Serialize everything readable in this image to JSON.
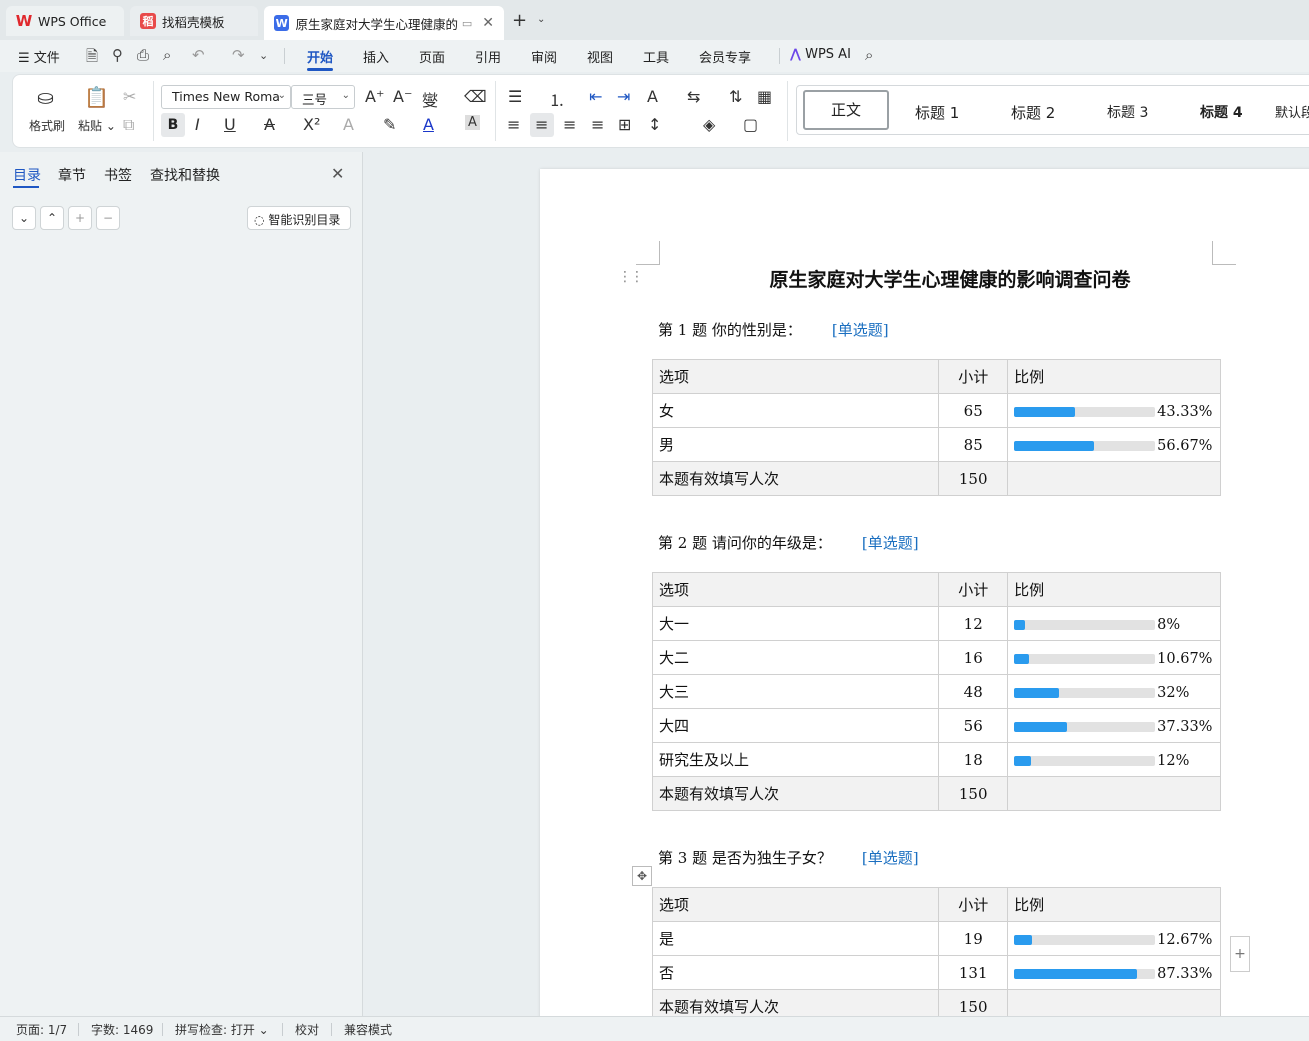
{
  "tabs": {
    "wps": "WPS Office",
    "templates": "找稻壳模板",
    "document": "原生家庭对大学生心理健康的影响调查问卷"
  },
  "menu": {
    "file": "文件",
    "items": [
      "开始",
      "插入",
      "页面",
      "引用",
      "审阅",
      "视图",
      "工具",
      "会员专享"
    ],
    "wps_ai": "WPS AI"
  },
  "ribbon": {
    "format_painter": "格式刷",
    "paste": "粘贴",
    "font_name": "Times New Roma",
    "font_size": "三号",
    "styles": [
      "正文",
      "标题 1",
      "标题 2",
      "标题 3",
      "标题 4",
      "默认段"
    ]
  },
  "nav": {
    "tabs": [
      "目录",
      "章节",
      "书签",
      "查找和替换"
    ],
    "smart_toc": "智能识别目录"
  },
  "document": {
    "title": "原生家庭对大学生心理健康的影响调查问卷",
    "headers": {
      "option": "选项",
      "count": "小计",
      "ratio": "比例"
    },
    "total_label": "本题有效填写人次",
    "questions": [
      {
        "title": "第 1 题   你的性别是：",
        "type": "[单选题]",
        "rows": [
          {
            "option": "女",
            "count": "65",
            "percent": "43.33%",
            "fraction": 0.4333
          },
          {
            "option": "男",
            "count": "85",
            "percent": "56.67%",
            "fraction": 0.5667
          }
        ],
        "total": "150"
      },
      {
        "title": "第 2 题   请问你的年级是：",
        "type": "[单选题]",
        "rows": [
          {
            "option": "大一",
            "count": "12",
            "percent": "8%",
            "fraction": 0.08
          },
          {
            "option": "大二",
            "count": "16",
            "percent": "10.67%",
            "fraction": 0.1067
          },
          {
            "option": "大三",
            "count": "48",
            "percent": "32%",
            "fraction": 0.32
          },
          {
            "option": "大四",
            "count": "56",
            "percent": "37.33%",
            "fraction": 0.3733
          },
          {
            "option": "研究生及以上",
            "count": "18",
            "percent": "12%",
            "fraction": 0.12
          }
        ],
        "total": "150"
      },
      {
        "title": "第 3 题    是否为独生子女？",
        "type": "[单选题]",
        "rows": [
          {
            "option": "是",
            "count": "19",
            "percent": "12.67%",
            "fraction": 0.1267
          },
          {
            "option": "否",
            "count": "131",
            "percent": "87.33%",
            "fraction": 0.8733
          }
        ],
        "total": "150"
      }
    ]
  },
  "status": {
    "page": "页面: 1/7",
    "words": "字数: 1469",
    "spellcheck": "拼写检查: 打开",
    "proof": "校对",
    "compat": "兼容模式"
  },
  "colors": {
    "accent": "#1f57c3",
    "bar": "#2a9bee",
    "link": "#1b6fc0"
  }
}
